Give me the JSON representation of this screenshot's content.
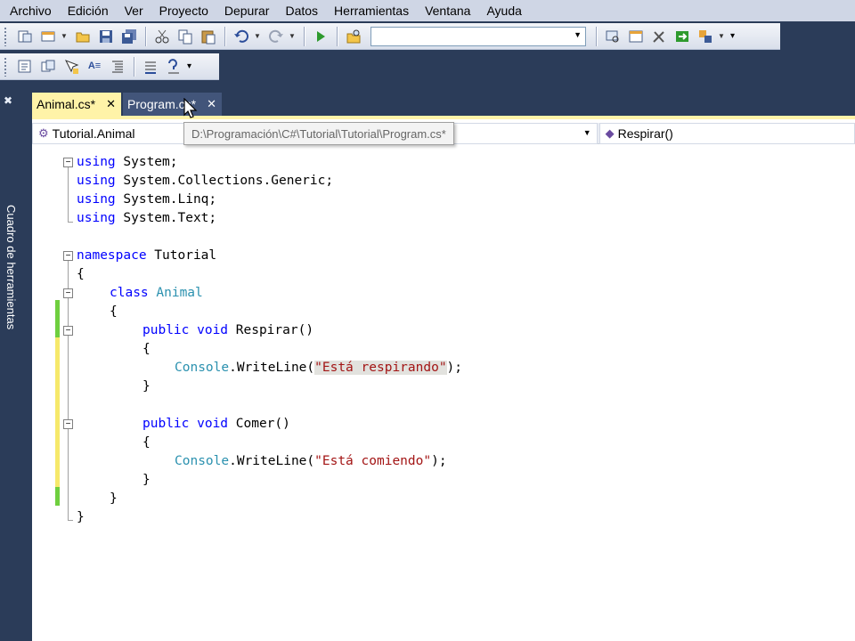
{
  "menu": [
    "Archivo",
    "Edición",
    "Ver",
    "Proyecto",
    "Depurar",
    "Datos",
    "Herramientas",
    "Ventana",
    "Ayuda"
  ],
  "toolbar": {
    "buttons": [
      "new-project-icon",
      "add-item-icon",
      "open-file-icon",
      "save-icon",
      "save-all-icon",
      "cut-icon",
      "copy-icon",
      "paste-icon",
      "undo-icon",
      "redo-icon",
      "start-debug-icon",
      "find-in-files-icon",
      "solution-explorer-icon",
      "properties-icon",
      "toolbox-icon",
      "object-browser-icon",
      "start-page-icon"
    ],
    "config_value": ""
  },
  "sidebar": {
    "label": "Cuadro de herramientas"
  },
  "tabs": [
    {
      "label": "Animal.cs*",
      "active": true
    },
    {
      "label": "Program.cs*",
      "active": false
    }
  ],
  "tooltip": "D:\\Programación\\C#\\Tutorial\\Tutorial\\Program.cs*",
  "navbar": {
    "type": "Tutorial.Animal",
    "member": "Respirar()"
  },
  "colors": {
    "keyword": "#0000ff",
    "type": "#2b91af",
    "string": "#a31515",
    "tab_active": "#fff3a8",
    "chrome": "#2b3c59"
  },
  "code": {
    "l1": [
      "using",
      " System;"
    ],
    "l2": [
      "using",
      " System.Collections.Generic;"
    ],
    "l3": [
      "using",
      " System.Linq;"
    ],
    "l4": [
      "using",
      " System.Text;"
    ],
    "l6": [
      "namespace",
      " Tutorial"
    ],
    "l7": "{",
    "l8": [
      "class",
      "Animal"
    ],
    "l9": "{",
    "l10": [
      "public void",
      " Respirar()"
    ],
    "l11": "{",
    "l12": [
      "Console",
      ".WriteLine(",
      "\"Está respirando\"",
      ");"
    ],
    "l13": "}",
    "l15": [
      "public void",
      " Comer()"
    ],
    "l16": "{",
    "l17": [
      "Console",
      ".WriteLine(",
      "\"Está comiendo\"",
      ");"
    ],
    "l18": "}",
    "l19": "}",
    "l20": "}"
  }
}
